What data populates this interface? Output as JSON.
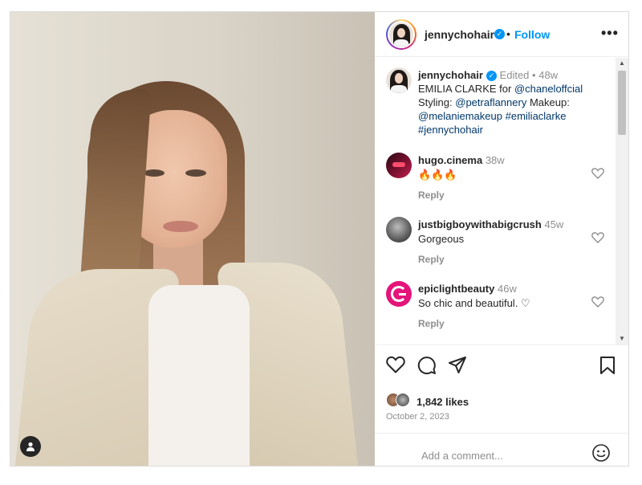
{
  "post": {
    "username": "jennychohair",
    "follow_label": "Follow",
    "header_dot": "•",
    "more_label": "•••",
    "caption": {
      "username": "jennychohair",
      "edited": "Edited",
      "time_sep": "•",
      "time": "48w",
      "text_1": "EMILIA CLARKE for ",
      "mention_1": "@chaneloffcial",
      "text_2": "Styling: ",
      "mention_2": "@petraflannery",
      "text_3": " Makeup:",
      "mention_3": "@melaniemakeup",
      "hashtag_1": "#emiliaclarke",
      "hashtag_2": "#jennychohair"
    },
    "comments": [
      {
        "username": "hugo.cinema",
        "time": "38w",
        "text": "🔥🔥🔥",
        "reply": "Reply"
      },
      {
        "username": "justbigboywithabigcrush",
        "time": "45w",
        "text": "Gorgeous",
        "reply": "Reply"
      },
      {
        "username": "epiclightbeauty",
        "time": "46w",
        "text": "So chic and beautiful. ♡",
        "reply": "Reply"
      }
    ],
    "likes": "1,842 likes",
    "date": "October 2, 2023",
    "add_comment_placeholder": "Add a comment..."
  },
  "icons": {
    "header": [
      "verified-icon",
      "more-options-icon"
    ],
    "actions": [
      "heart-icon",
      "comment-icon",
      "share-icon",
      "bookmark-icon"
    ],
    "other": [
      "user-tag-icon",
      "emoji-icon",
      "comment-heart-icon"
    ]
  },
  "colors": {
    "accent": "#0095f6",
    "link": "#00376b",
    "text": "#262626",
    "muted": "#8e8e8e",
    "border": "#dbdbdb"
  }
}
